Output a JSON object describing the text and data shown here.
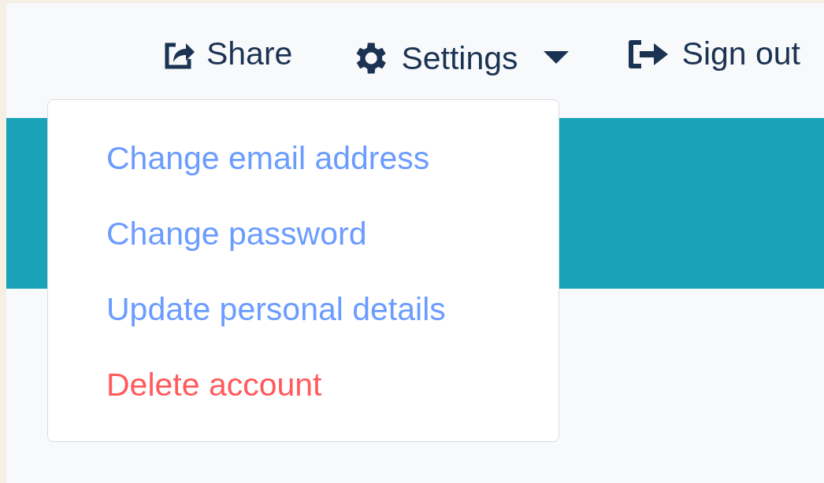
{
  "nav": [
    {
      "label": "Share",
      "kind": "share"
    },
    {
      "label": "Settings",
      "kind": "settings",
      "expanded": true
    },
    {
      "label": "Sign out",
      "kind": "signout"
    }
  ],
  "settings_menu": [
    {
      "label": "Change email address",
      "kind": "normal"
    },
    {
      "label": "Change password",
      "kind": "normal"
    },
    {
      "label": "Update personal details",
      "kind": "normal"
    },
    {
      "label": "Delete account",
      "kind": "danger"
    }
  ]
}
